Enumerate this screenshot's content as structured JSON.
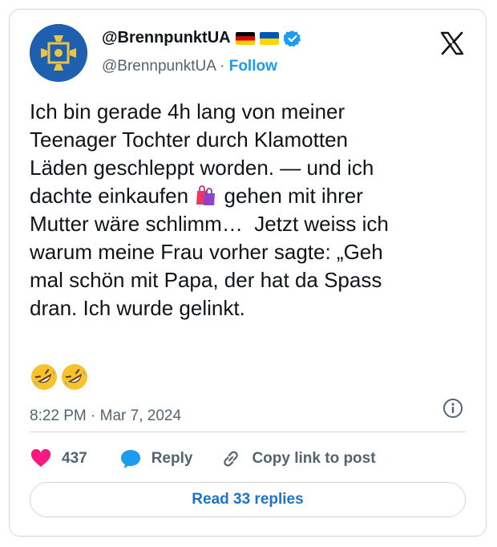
{
  "author": {
    "display_name": "@BrennpunktUA",
    "handle": "@BrennpunktUA",
    "separator": "·",
    "follow_label": "Follow",
    "flags": [
      "germany-flag",
      "ukraine-flag"
    ],
    "verified": true
  },
  "tweet": {
    "text_before_emoji": "Ich bin gerade 4h lang von meiner\nTeenager Tochter durch Klamotten\nLäden geschleppt worden. — und ich\ndachte einkaufen ",
    "inline_emoji": "shopping-bags-icon",
    "text_after_emoji": " gehen mit ihrer\nMutter wäre schlimm…  Jetzt weiss ich\nwarum meine Frau vorher sagte: „Geh\nmal schön mit Papa, der hat da Spass\ndran. Ich wurde gelinkt.",
    "trailing_emojis": [
      "rolling-on-floor-laughing-icon",
      "rolling-on-floor-laughing-icon"
    ],
    "timestamp": "8:22 PM · Mar 7, 2024"
  },
  "actions": {
    "likes_count": "437",
    "reply_label": "Reply",
    "copy_link_label": "Copy link to post"
  },
  "footer": {
    "read_replies_label": "Read 33 replies"
  },
  "colors": {
    "like": "#f91880",
    "reply": "#1d9bf0",
    "follow": "#1d9bf0",
    "text": "#0f1419",
    "muted": "#536471",
    "border": "#cfd9de"
  }
}
